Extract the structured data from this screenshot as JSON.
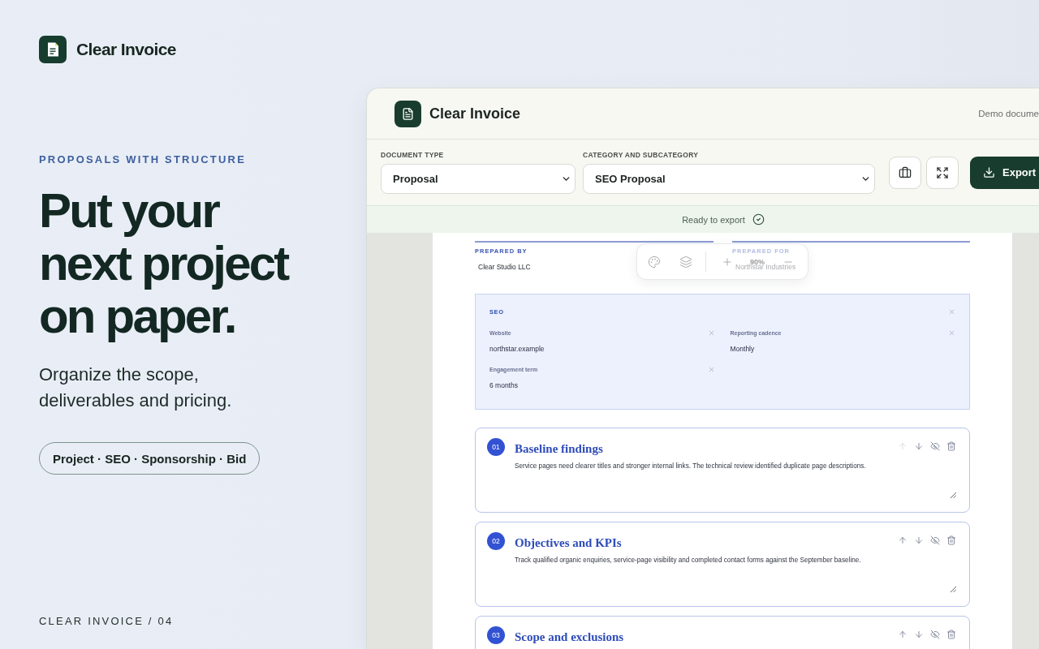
{
  "brand": {
    "name": "Clear Invoice"
  },
  "hero": {
    "eyebrow": "PROPOSALS WITH STRUCTURE",
    "headline_lines": [
      "Put your",
      "next project",
      "on paper."
    ],
    "subtitle": "Organize the scope, deliverables and pricing.",
    "tags": "Project · SEO · Sponsorship · Bid"
  },
  "footer": "CLEAR INVOICE / 04",
  "app": {
    "title": "Clear Invoice",
    "header_note": "Demo docume",
    "selects": [
      {
        "label": "DOCUMENT TYPE",
        "value": "Proposal"
      },
      {
        "label": "CATEGORY AND SUBCATEGORY",
        "value": "SEO Proposal"
      }
    ],
    "export_label": "Export",
    "status": "Ready to export",
    "zoom": "90%",
    "document": {
      "parties": [
        {
          "label": "PREPARED BY",
          "value": "Clear Studio LLC"
        },
        {
          "label": "PREPARED FOR",
          "value": "Northstar Industries"
        }
      ],
      "details": {
        "title": "SEO",
        "fields": [
          {
            "label": "Website",
            "value": "northstar.example"
          },
          {
            "label": "Reporting cadence",
            "value": "Monthly"
          },
          {
            "label": "Engagement term",
            "value": "6 months"
          }
        ]
      },
      "sections": [
        {
          "number": "01",
          "title": "Baseline findings",
          "body": "Service pages need clearer titles and stronger internal links. The technical review identified duplicate page descriptions.",
          "move_up_disabled": true
        },
        {
          "number": "02",
          "title": "Objectives and KPIs",
          "body": "Track qualified organic enquiries, service-page visibility and completed contact forms against the September baseline.",
          "move_up_disabled": false
        },
        {
          "number": "03",
          "title": "Scope and exclusions",
          "move_up_disabled": false
        }
      ]
    }
  }
}
